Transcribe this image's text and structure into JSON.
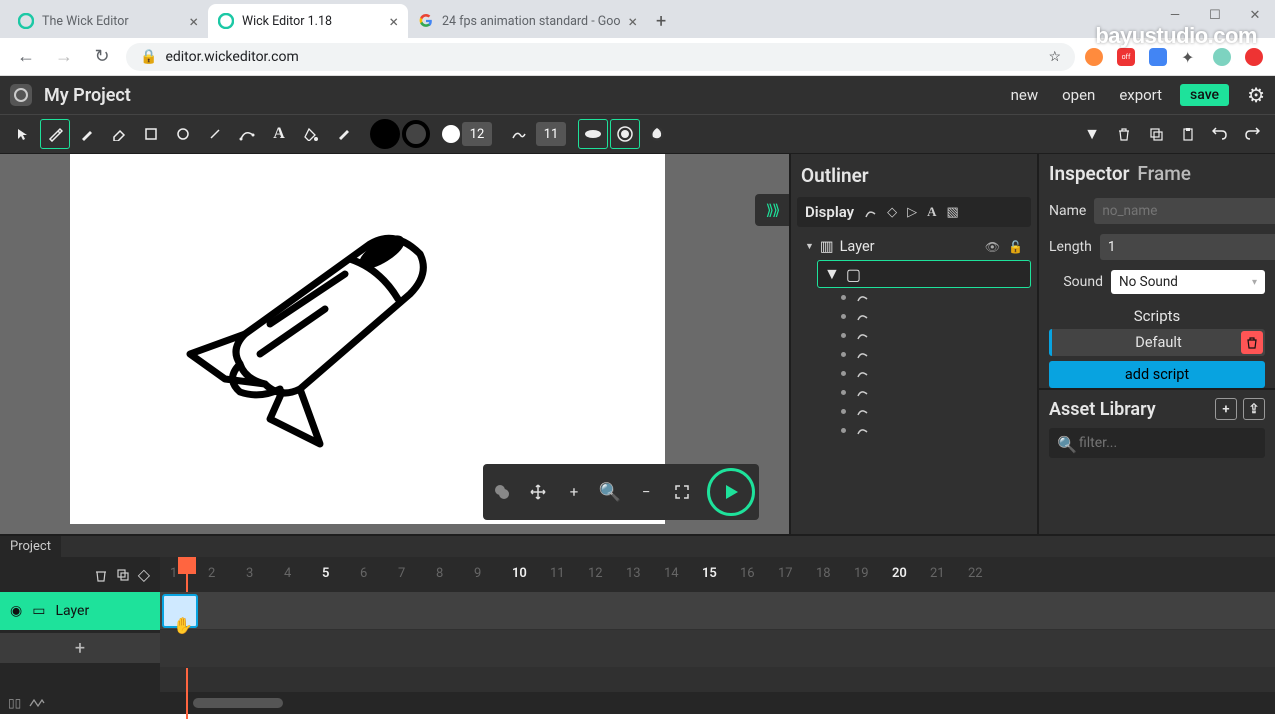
{
  "browser": {
    "tabs": [
      {
        "title": "The Wick Editor",
        "icon": "#1cc8a5"
      },
      {
        "title": "Wick Editor 1.18",
        "icon": "#1cc8a5",
        "active": true
      },
      {
        "title": "24 fps animation standard - Goo",
        "icon": "google"
      }
    ],
    "url": "editor.wickeditor.com",
    "back": "←",
    "forward": "→",
    "reload": "↻"
  },
  "watermark": "bayustudio.com",
  "app": {
    "title": "My Project",
    "menu": {
      "new": "new",
      "open": "open",
      "export": "export",
      "save": "save"
    }
  },
  "toolbar": {
    "stroke_size": "12",
    "curve_size": "11"
  },
  "outliner": {
    "title": "Outliner",
    "display": "Display",
    "layer": "Layer",
    "paths_count": 8
  },
  "inspector": {
    "title": "Inspector",
    "subtitle": "Frame",
    "name_label": "Name",
    "name_placeholder": "no_name",
    "length_label": "Length",
    "length_value": "1",
    "sound_label": "Sound",
    "sound_value": "No Sound",
    "scripts_title": "Scripts",
    "default_script": "Default",
    "add_script": "add script"
  },
  "assets": {
    "title": "Asset Library",
    "filter_placeholder": "filter..."
  },
  "timeline": {
    "tab": "Project",
    "layer": "Layer",
    "add": "+",
    "ruler_marks": [
      1,
      2,
      3,
      4,
      5,
      6,
      7,
      8,
      9,
      10,
      11,
      12,
      13,
      14,
      15,
      16,
      17,
      18,
      19,
      20,
      21,
      22
    ],
    "major_every": 5
  }
}
